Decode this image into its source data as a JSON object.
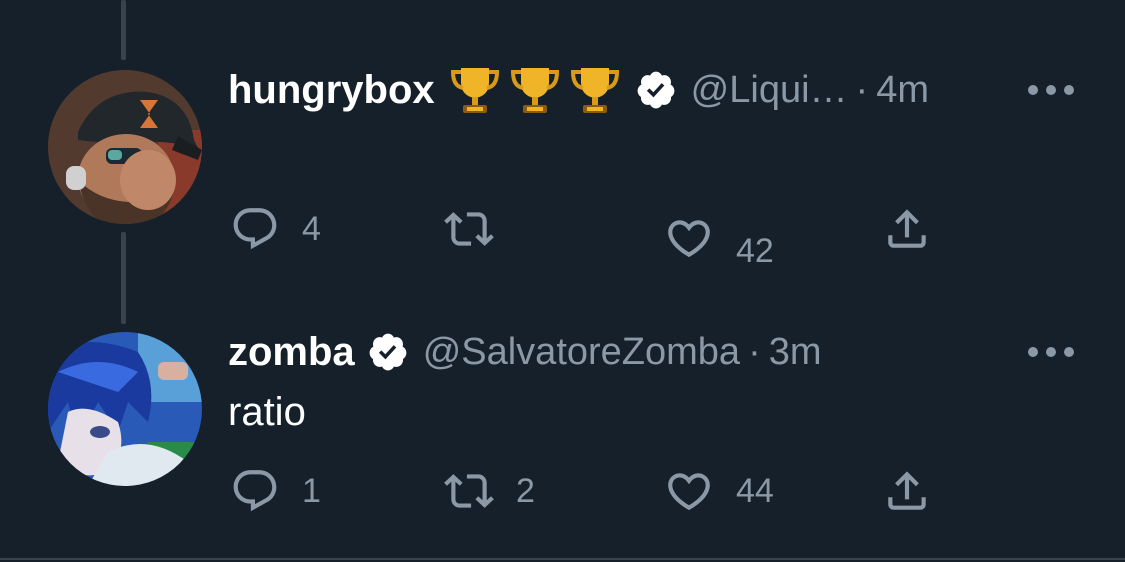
{
  "tweets": [
    {
      "display_name": "hungrybox",
      "emoji": "🏆🏆🏆",
      "handle": "@Liqui…",
      "dot": "·",
      "time": "4m",
      "text": "",
      "actions": {
        "reply": "4",
        "retweet": "",
        "like": "42"
      }
    },
    {
      "display_name": "zomba",
      "emoji": "",
      "handle": "@SalvatoreZomba",
      "dot": "·",
      "time": "3m",
      "text": "ratio",
      "actions": {
        "reply": "1",
        "retweet": "2",
        "like": "44"
      }
    }
  ],
  "colors": {
    "background": "#15202b",
    "secondary_text": "#8b98a5",
    "thread_line": "#38444d"
  },
  "icons": [
    "reply-icon",
    "retweet-icon",
    "like-icon",
    "share-icon",
    "verified-badge-icon",
    "more-options-icon"
  ]
}
